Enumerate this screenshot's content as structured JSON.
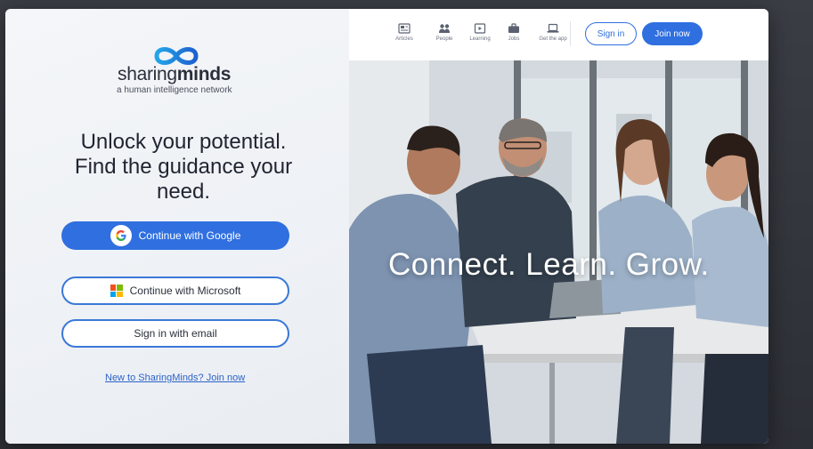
{
  "brand": {
    "name_part1": "sharing",
    "name_part2": "minds",
    "tagline": "a human intelligence network"
  },
  "headline": "Unlock your potential. Find the guidance your need.",
  "auth": {
    "google_label": "Continue with Google",
    "microsoft_label": "Continue with Microsoft",
    "email_label": "Sign in with email",
    "join_link": "New to SharingMinds? Join now"
  },
  "nav": {
    "items": [
      {
        "label": "Articles",
        "icon": "article-icon"
      },
      {
        "label": "People",
        "icon": "people-icon"
      },
      {
        "label": "Learning",
        "icon": "learning-icon"
      },
      {
        "label": "Jobs",
        "icon": "briefcase-icon"
      },
      {
        "label": "Get the app",
        "icon": "laptop-icon"
      }
    ],
    "signin_label": "Sign in",
    "join_label": "Join now"
  },
  "hero": {
    "overlay_text": "Connect. Learn. Grow."
  },
  "colors": {
    "accent": "#2f6fe0",
    "logo_blue": "#1e6fd9",
    "logo_cyan": "#23a6e8"
  }
}
